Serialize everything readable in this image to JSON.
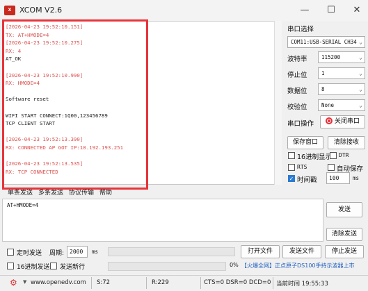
{
  "window": {
    "title": "XCOM V2.6"
  },
  "log": [
    {
      "text": "[2026-04-23 19:52:10.151]",
      "color": "red"
    },
    {
      "text": "TX: AT+HMODE=4",
      "color": "red"
    },
    {
      "text": "[2026-04-23 19:52:10.275]",
      "color": "red"
    },
    {
      "text": "RX: 4",
      "color": "red"
    },
    {
      "text": "AT_OK",
      "color": "black"
    },
    {
      "text": "",
      "color": "black"
    },
    {
      "text": "[2026-04-23 19:52:10.990]",
      "color": "red"
    },
    {
      "text": "RX: HMODE=4",
      "color": "red"
    },
    {
      "text": "",
      "color": "black"
    },
    {
      "text": "Software reset",
      "color": "black"
    },
    {
      "text": "",
      "color": "black"
    },
    {
      "text": "WIFI START CONNECT:1Q00,123456789",
      "color": "black"
    },
    {
      "text": "TCP CLIENT START",
      "color": "black"
    },
    {
      "text": "",
      "color": "black"
    },
    {
      "text": "[2026-04-23 19:52:13.390]",
      "color": "red"
    },
    {
      "text": "RX: CONNECTED AP GOT IP:10.192.193.251",
      "color": "red"
    },
    {
      "text": "",
      "color": "black"
    },
    {
      "text": "[2026-04-23 19:52:13.535]",
      "color": "red"
    },
    {
      "text": "RX: TCP CONNECTED",
      "color": "red"
    }
  ],
  "right_panel": {
    "port_select_label": "串口选择",
    "port_value": "COM11:USB-SERIAL CH34",
    "baud_label": "波特率",
    "baud_value": "115200",
    "stop_label": "停止位",
    "stop_value": "1",
    "data_label": "数据位",
    "data_value": "8",
    "parity_label": "校验位",
    "parity_value": "None",
    "port_op_label": "串口操作",
    "close_port_label": "关闭串口",
    "save_window_label": "保存窗口",
    "clear_recv_label": "清除接收",
    "hex_display_label": "16进制显示",
    "dtr_label": "DTR",
    "rts_label": "RTS",
    "auto_save_label": "自动保存",
    "timestamp_label": "时间戳",
    "timestamp_value": "100",
    "timestamp_unit": "ms"
  },
  "tabs": [
    "单条发送",
    "多条发送",
    "协议传输",
    "帮助"
  ],
  "send": {
    "text": "AT+HMODE=4",
    "send_label": "发送",
    "clear_send_label": "清除发送"
  },
  "bottom": {
    "timed_send_label": "定时发送",
    "period_label": "周期:",
    "period_value": "2000",
    "period_unit": "ms",
    "open_file_label": "打开文件",
    "send_file_label": "发送文件",
    "stop_send_label": "停止发送",
    "hex_send_label": "16进制发送",
    "send_newline_label": "发送新行",
    "progress_percent": "0%",
    "promo_text": "【火爆全网】正点原子DS100手持示波器上市"
  },
  "status": {
    "website": "www.openedv.com",
    "sent": "S:72",
    "received": "R:229",
    "signals": "CTS=0 DSR=0 DCD=0",
    "time": "当前时间 19:55:33"
  },
  "colors": {
    "accent_red": "#e8333a",
    "log_red": "#d9534f",
    "checked_blue": "#2b7bd3"
  }
}
